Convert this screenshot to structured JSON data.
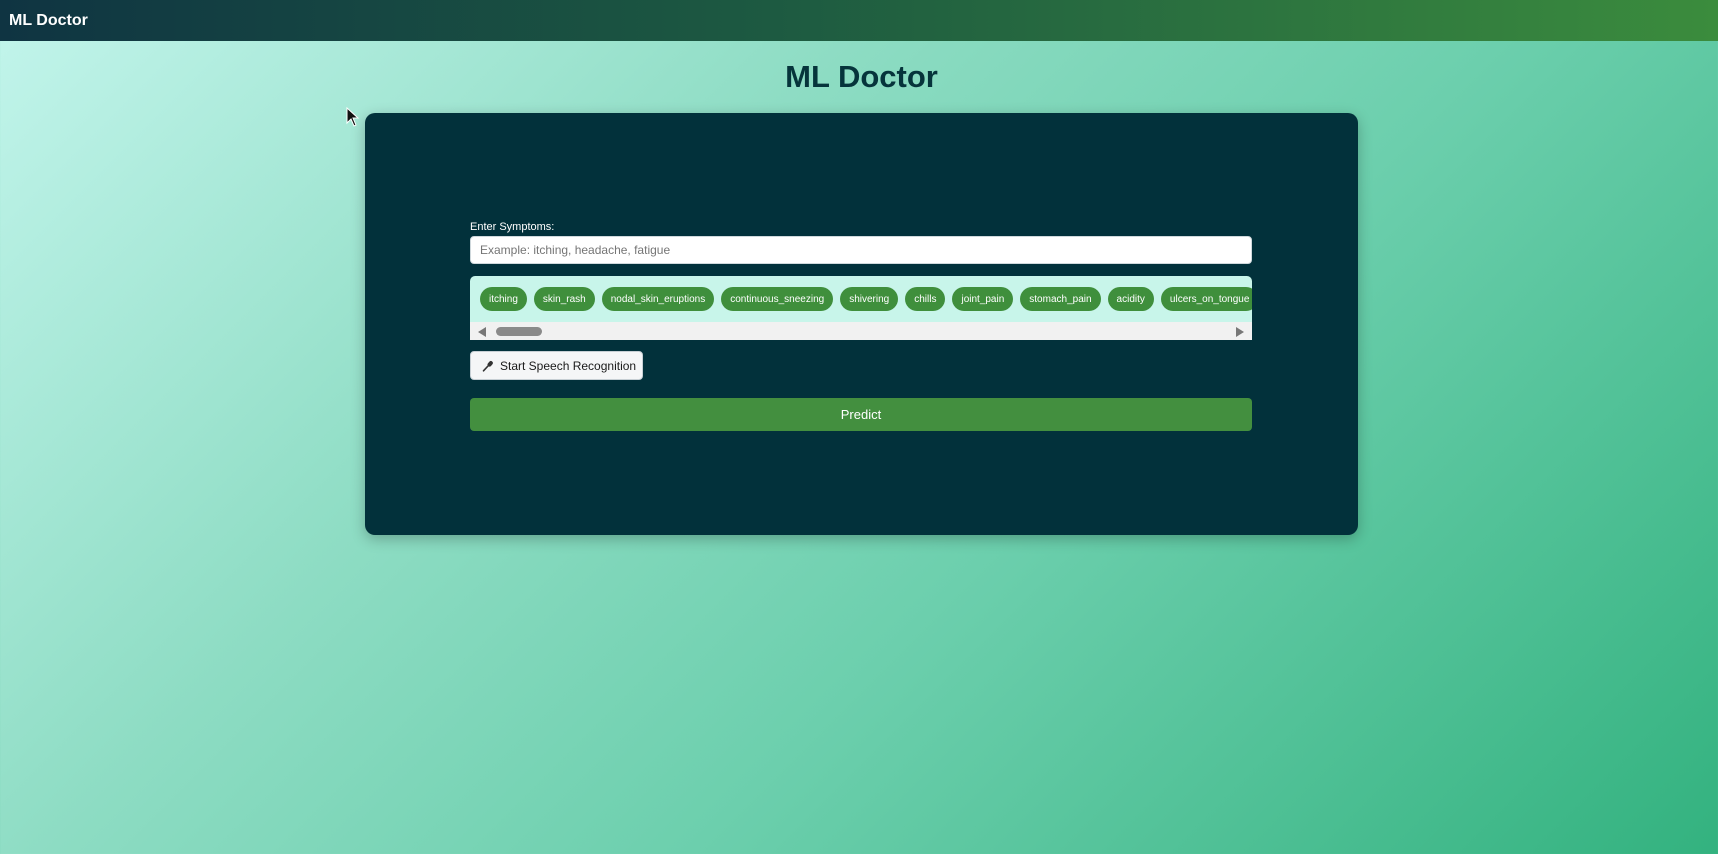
{
  "navbar": {
    "brand": "ML Doctor"
  },
  "page": {
    "title": "ML Doctor"
  },
  "form": {
    "symptom_label": "Enter Symptoms:",
    "symptom_placeholder": "Example: itching, headache, fatigue",
    "symptom_value": "",
    "chips": [
      "itching",
      "skin_rash",
      "nodal_skin_eruptions",
      "continuous_sneezing",
      "shivering",
      "chills",
      "joint_pain",
      "stomach_pain",
      "acidity",
      "ulcers_on_tongue"
    ],
    "speech_button_label": "Start Speech Recognition",
    "speech_icon": "microphone-icon",
    "predict_label": "Predict"
  },
  "colors": {
    "navbar_start": "#0f3442",
    "navbar_end": "#3b8c3d",
    "card_bg": "#02313b",
    "chip_bg": "#3f8f3c",
    "predict_bg": "#438f3f",
    "title_color": "#06343b"
  }
}
